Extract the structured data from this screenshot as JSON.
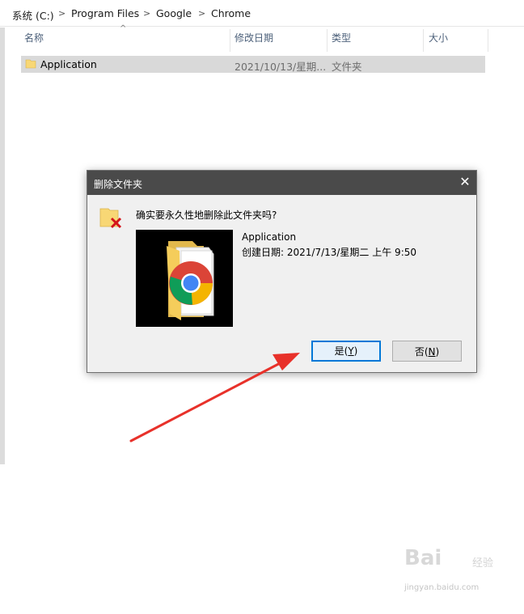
{
  "breadcrumb": {
    "items": [
      "系统 (C:)",
      "Program Files",
      "Google",
      "Chrome"
    ],
    "separator": ">"
  },
  "columns": {
    "name": "名称",
    "modified": "修改日期",
    "type": "类型",
    "size": "大小"
  },
  "files": [
    {
      "name": "Application",
      "modified": "2021/10/13/星期...",
      "type": "文件夹",
      "size": ""
    }
  ],
  "dialog": {
    "title": "删除文件夹",
    "close_glyph": "✕",
    "question": "确实要永久性地删除此文件夹吗?",
    "item_name": "Application",
    "created": "创建日期: 2021/7/13/星期二 上午 9:50",
    "yes_button": {
      "text": "是",
      "mnemonic": "Y"
    },
    "no_button": {
      "text": "否",
      "mnemonic": "N"
    }
  },
  "icons": {
    "folder": "folder-icon",
    "delete_warning": "folder-delete-icon",
    "chrome_folder": "chrome-folder-icon",
    "annotation_arrow": "red-arrow"
  },
  "colors": {
    "titlebar": "#4a4a4a",
    "selected_row": "#d9d9d9",
    "default_button_border": "#0078d7",
    "arrow": "#e8312a",
    "folder": "#f8d775"
  },
  "watermark": {
    "brand": "Bai",
    "brand_suffix": "经验",
    "url": "jingyan.baidu.com"
  }
}
